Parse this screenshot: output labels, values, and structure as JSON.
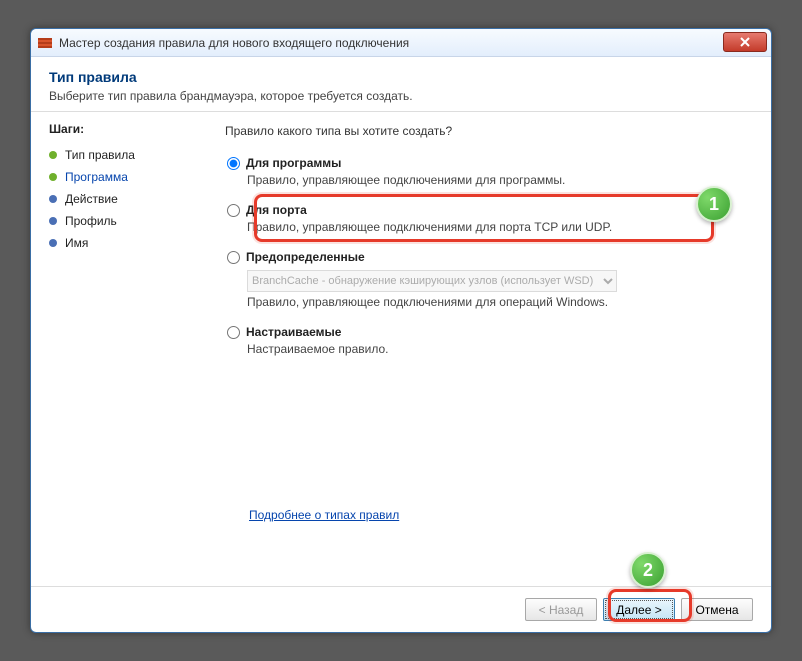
{
  "window": {
    "title": "Мастер создания правила для нового входящего подключения"
  },
  "header": {
    "title": "Тип правила",
    "subtitle": "Выберите тип правила брандмауэра, которое требуется создать."
  },
  "steps": {
    "title": "Шаги:",
    "items": [
      {
        "label": "Тип правила",
        "state": "current"
      },
      {
        "label": "Программа",
        "state": "link"
      },
      {
        "label": "Действие",
        "state": "pending"
      },
      {
        "label": "Профиль",
        "state": "pending"
      },
      {
        "label": "Имя",
        "state": "pending"
      }
    ]
  },
  "main": {
    "question": "Правило какого типа вы хотите создать?",
    "options": [
      {
        "id": "program",
        "title": "Для программы",
        "desc": "Правило, управляющее подключениями для программы.",
        "selected": true
      },
      {
        "id": "port",
        "title": "Для порта",
        "desc": "Правило, управляющее подключениями для порта TCP или UDP.",
        "selected": false
      },
      {
        "id": "predefined",
        "title": "Предопределенные",
        "desc": "Правило, управляющее подключениями для операций Windows.",
        "selected": false,
        "dropdown": "BranchCache - обнаружение кэширующих узлов (использует WSD)"
      },
      {
        "id": "custom",
        "title": "Настраиваемые",
        "desc": "Настраиваемое правило.",
        "selected": false
      }
    ],
    "learn_more": "Подробнее о типах правил"
  },
  "buttons": {
    "back": "< Назад",
    "next": "Далее >",
    "cancel": "Отмена"
  },
  "annotations": {
    "n1": "1",
    "n2": "2"
  }
}
